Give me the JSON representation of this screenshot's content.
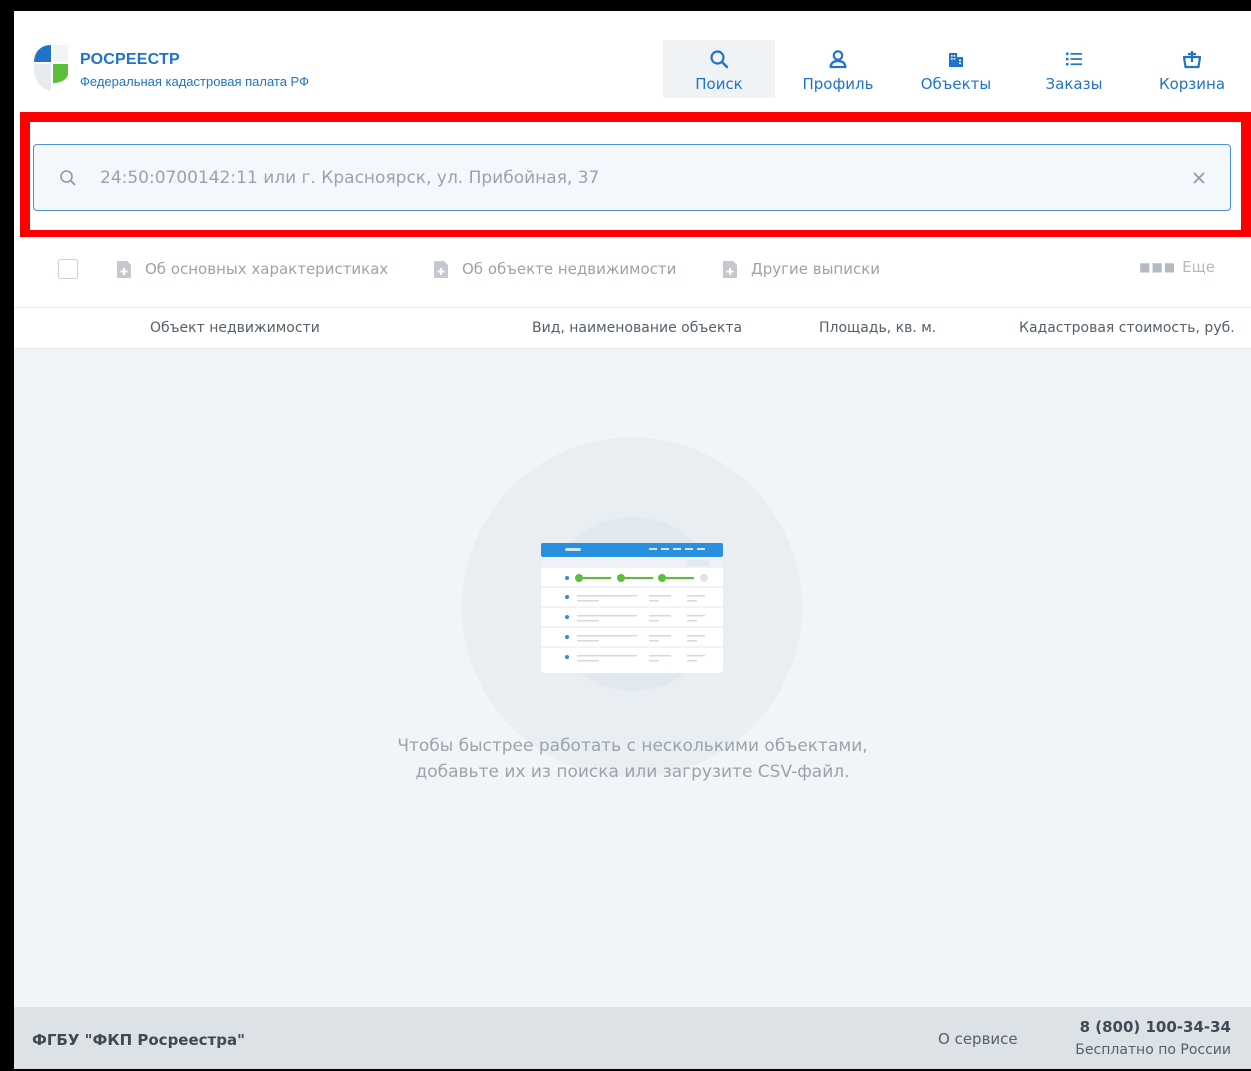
{
  "header": {
    "brand": "РОСРЕЕСТР",
    "subtitle": "Федеральная кадастровая палата РФ",
    "nav": [
      {
        "label": "Поиск",
        "icon": "search-icon",
        "active": true
      },
      {
        "label": "Профиль",
        "icon": "user-icon"
      },
      {
        "label": "Объекты",
        "icon": "buildings-icon"
      },
      {
        "label": "Заказы",
        "icon": "list-icon"
      },
      {
        "label": "Корзина",
        "icon": "basket-icon"
      }
    ]
  },
  "search": {
    "value": "",
    "placeholder": "24:50:0700142:11 или г. Красноярск, ул. Прибойная, 37"
  },
  "toolbar": {
    "actions": [
      "Об основных характеристиках",
      "Об объекте недвижимости",
      "Другие выписки"
    ],
    "more_label": "Еще"
  },
  "table": {
    "columns": [
      "Объект недвижимости",
      "Вид, наименование объекта",
      "Площадь, кв. м.",
      "Кадастровая стоимость, руб."
    ]
  },
  "empty_state": {
    "line1": "Чтобы быстрее работать с несколькими объектами,",
    "line2": "добавьте их из поиска или загрузите CSV-файл."
  },
  "footer": {
    "org": "ФГБУ \"ФКП Росреестра\"",
    "about": "О сервисе",
    "phone": "8 (800) 100-34-34",
    "phone_note": "Бесплатно по России"
  },
  "colors": {
    "accent": "#2173c7",
    "highlight": "#ff0000",
    "success": "#5bbf3a"
  }
}
